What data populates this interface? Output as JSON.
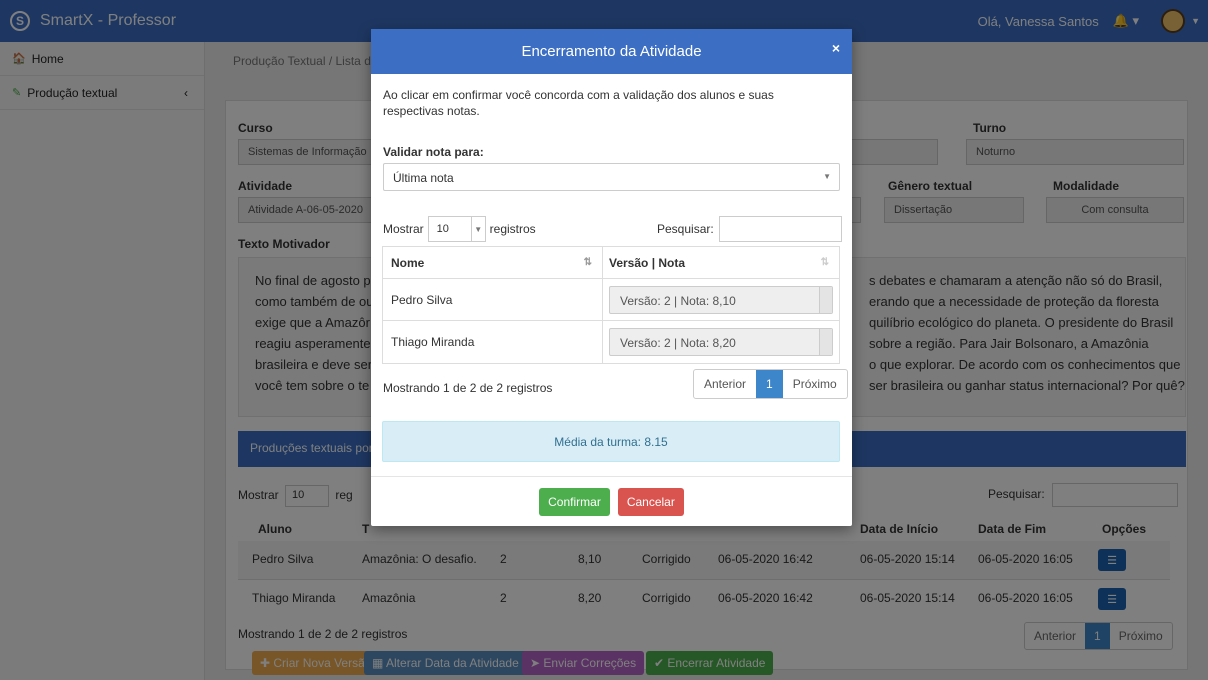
{
  "app": {
    "title": "SmartX - Professor",
    "logo_letter": "S",
    "greeting": "Olá, Vanessa Santos"
  },
  "sidebar": {
    "items": [
      {
        "label": "Home"
      },
      {
        "label": "Produção textual"
      }
    ]
  },
  "breadcrumb": "Produção Textual / Lista de",
  "form": {
    "curso_label": "Curso",
    "curso_value": "Sistemas de Informação",
    "turno_label": "Turno",
    "turno_value": "Noturno",
    "atividade_label": "Atividade",
    "atividade_value": "Atividade A-06-05-2020",
    "genero_label": "Gênero textual",
    "genero_value": "Dissertação",
    "modalidade_label": "Modalidade",
    "modalidade_value": "Com consulta",
    "texto_label": "Texto Motivador",
    "texto_left": [
      "No final de agosto p",
      "como também de ou",
      "exige que a Amazôr",
      "reagiu asperamente",
      "brasileira e deve ser",
      "você tem sobre o te"
    ],
    "texto_right": [
      "s debates e chamaram a atenção não só do Brasil,",
      "erando que a necessidade de proteção da floresta",
      "quilíbrio ecológico do planeta. O presidente do Brasil",
      "sobre a região. Para Jair Bolsonaro, a Amazônia",
      "o que explorar. De acordo com os conhecimentos que",
      "ser brasileira ou ganhar status internacional? Por quê?"
    ]
  },
  "producoes": {
    "header": "Produções textuais por",
    "show_label": "Mostrar",
    "show_value": "10",
    "show_suffix": "reg",
    "search_label": "Pesquisar:",
    "columns": {
      "aluno": "Aluno",
      "t": "T",
      "data_inicio": "Data de Início",
      "data_fim": "Data de Fim",
      "opcoes": "Opções"
    },
    "rows": [
      {
        "aluno": "Pedro Silva",
        "titulo": "Amazônia: O desafio.",
        "versao": "2",
        "nota": "8,10",
        "status": "Corrigido",
        "data_envio": "06-05-2020 16:42",
        "data_inicio": "06-05-2020 15:14",
        "data_fim": "06-05-2020 16:05"
      },
      {
        "aluno": "Thiago Miranda",
        "titulo": "Amazônia",
        "versao": "2",
        "nota": "8,20",
        "status": "Corrigido",
        "data_envio": "06-05-2020 16:42",
        "data_inicio": "06-05-2020 15:14",
        "data_fim": "06-05-2020 16:05"
      }
    ],
    "info": "Mostrando 1 de 2 de 2 registros",
    "pager": {
      "prev": "Anterior",
      "page": "1",
      "next": "Próximo"
    },
    "actions": {
      "criar": "Criar Nova Versão",
      "alterar": "Alterar Data da Atividade",
      "enviar": "Enviar Correções",
      "encerrar": "Encerrar Atividade"
    }
  },
  "modal": {
    "title": "Encerramento da Atividade",
    "close": "×",
    "description": "Ao clicar em confirmar você concorda com a validação dos alunos e suas respectivas notas.",
    "select_label": "Validar nota para:",
    "select_value": "Última nota",
    "show_label": "Mostrar",
    "show_value": "10",
    "show_suffix": "registros",
    "search_label": "Pesquisar:",
    "table": {
      "col_nome": "Nome",
      "col_versao": "Versão | Nota",
      "rows": [
        {
          "nome": "Pedro Silva",
          "versao": "Versão: 2 | Nota: 8,10"
        },
        {
          "nome": "Thiago Miranda",
          "versao": "Versão: 2 | Nota: 8,20"
        }
      ]
    },
    "info": "Mostrando 1 de 2 de 2 registros",
    "pager": {
      "prev": "Anterior",
      "page": "1",
      "next": "Próximo"
    },
    "media": "Média da turma: 8.15",
    "confirm": "Confirmar",
    "cancel": "Cancelar"
  },
  "colors": {
    "brand": "#3c6fc4",
    "confirm": "#4cae4c",
    "cancel": "#d9534f",
    "info_bg": "#d9edf7"
  }
}
